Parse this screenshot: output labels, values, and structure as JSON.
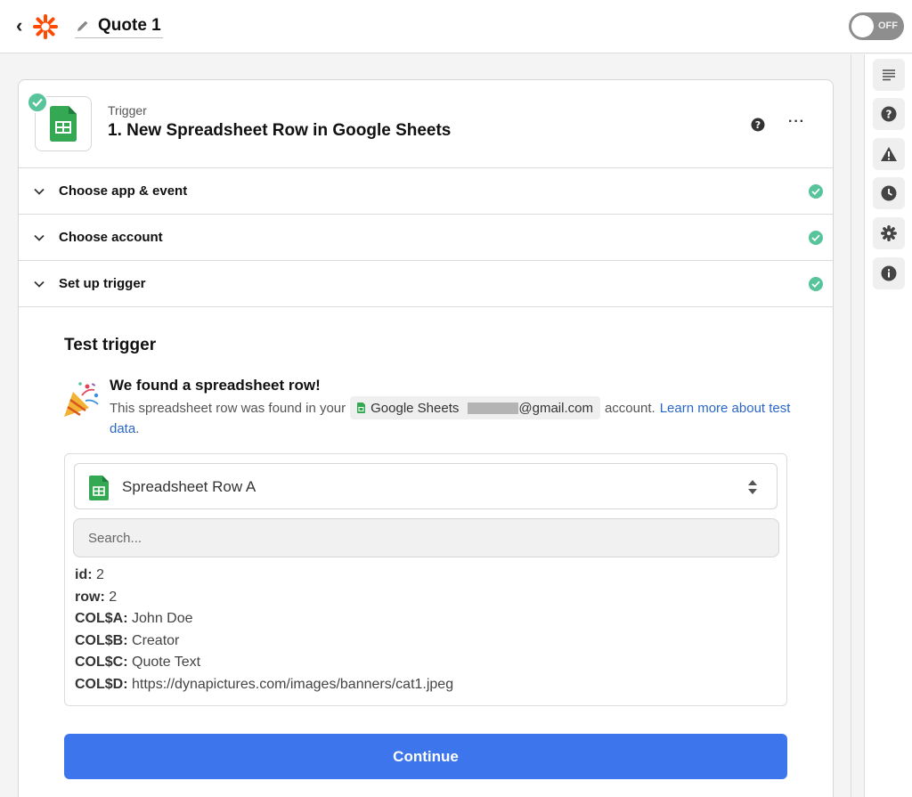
{
  "header": {
    "title": "Quote 1",
    "toggle_label": "OFF"
  },
  "colors": {
    "accent": "#3d76ec",
    "success": "#58c49b",
    "brand": "#ff4a00",
    "sheets_green": "#34a853"
  },
  "rail": {
    "icons": [
      "outline-icon",
      "help-icon",
      "warning-icon",
      "history-icon",
      "settings-icon",
      "info-icon"
    ]
  },
  "step": {
    "kind": "Trigger",
    "title": "1. New Spreadsheet Row in Google Sheets",
    "sections": [
      {
        "label": "Choose app & event"
      },
      {
        "label": "Choose account"
      },
      {
        "label": "Set up trigger"
      }
    ]
  },
  "test": {
    "heading": "Test trigger",
    "found_title": "We found a spreadsheet row!",
    "found_text_before": "This spreadsheet row was found in your",
    "account_app": "Google Sheets",
    "account_email_suffix": "@gmail.com",
    "found_text_after": "account.",
    "learn_more_part1": "Learn more about test",
    "learn_more_part2": "data",
    "period": "."
  },
  "result": {
    "selected_row": "Spreadsheet Row A",
    "search_placeholder": "Search...",
    "fields": [
      {
        "key": "id:",
        "value": "2"
      },
      {
        "key": "row:",
        "value": "2"
      },
      {
        "key": "COL$A:",
        "value": "John Doe"
      },
      {
        "key": "COL$B:",
        "value": "Creator"
      },
      {
        "key": "COL$C:",
        "value": "Quote Text"
      },
      {
        "key": "COL$D:",
        "value": "https://dynapictures.com/images/banners/cat1.jpeg"
      }
    ]
  },
  "continue_label": "Continue"
}
